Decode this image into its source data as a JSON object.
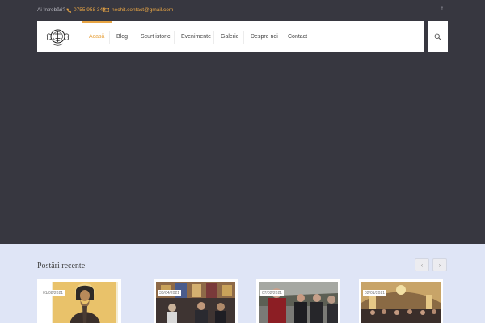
{
  "topbar": {
    "question": "Ai întrebări?",
    "phone": "0755 958 343",
    "email": "nechit.contact@gmail.com",
    "social_icon": "f"
  },
  "nav": {
    "items": [
      {
        "label": "Acasă",
        "active": true
      },
      {
        "label": "Blog"
      },
      {
        "label": "Scurt istoric"
      },
      {
        "label": "Evenimente"
      },
      {
        "label": "Galerie"
      },
      {
        "label": "Despre noi"
      },
      {
        "label": "Contact"
      }
    ],
    "accent_color": "#e8a544"
  },
  "recent": {
    "title": "Postări recente",
    "prev_icon": "‹",
    "next_icon": "›",
    "posts": [
      {
        "date": "01/08/2021"
      },
      {
        "date": "30/04/2021"
      },
      {
        "date": "07/02/2021"
      },
      {
        "date": "02/01/2021"
      }
    ]
  },
  "colors": {
    "hero_bg": "#373740",
    "recent_bg": "#dfe5f6",
    "accent": "#e8a544"
  }
}
